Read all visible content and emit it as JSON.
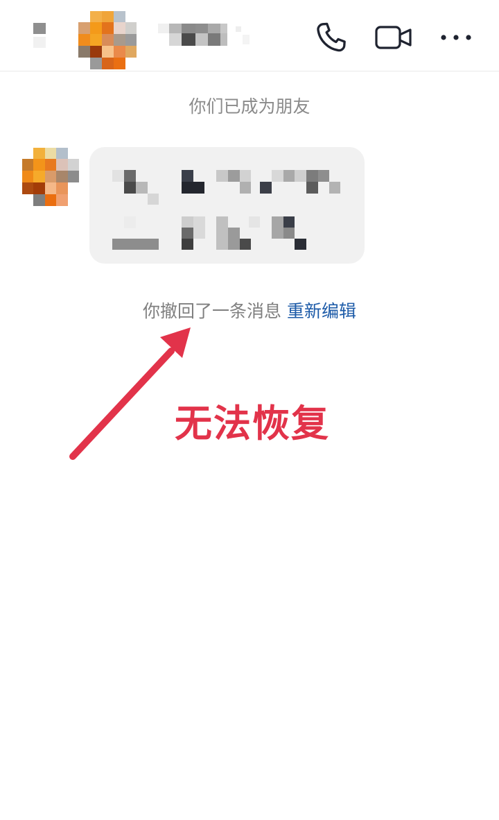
{
  "header": {
    "call_icon": "phone-icon",
    "video_icon": "video-camera-icon",
    "more_icon": "more-dots-icon"
  },
  "chat": {
    "friends_notice": "你们已成为朋友",
    "recall_notice": "你撤回了一条消息",
    "reedit_label": "重新编辑"
  },
  "annotation": {
    "text": "无法恢复",
    "color": "#e2334a"
  },
  "colors": {
    "link": "#1d5ba8",
    "bubble": "#f1f1f1"
  }
}
